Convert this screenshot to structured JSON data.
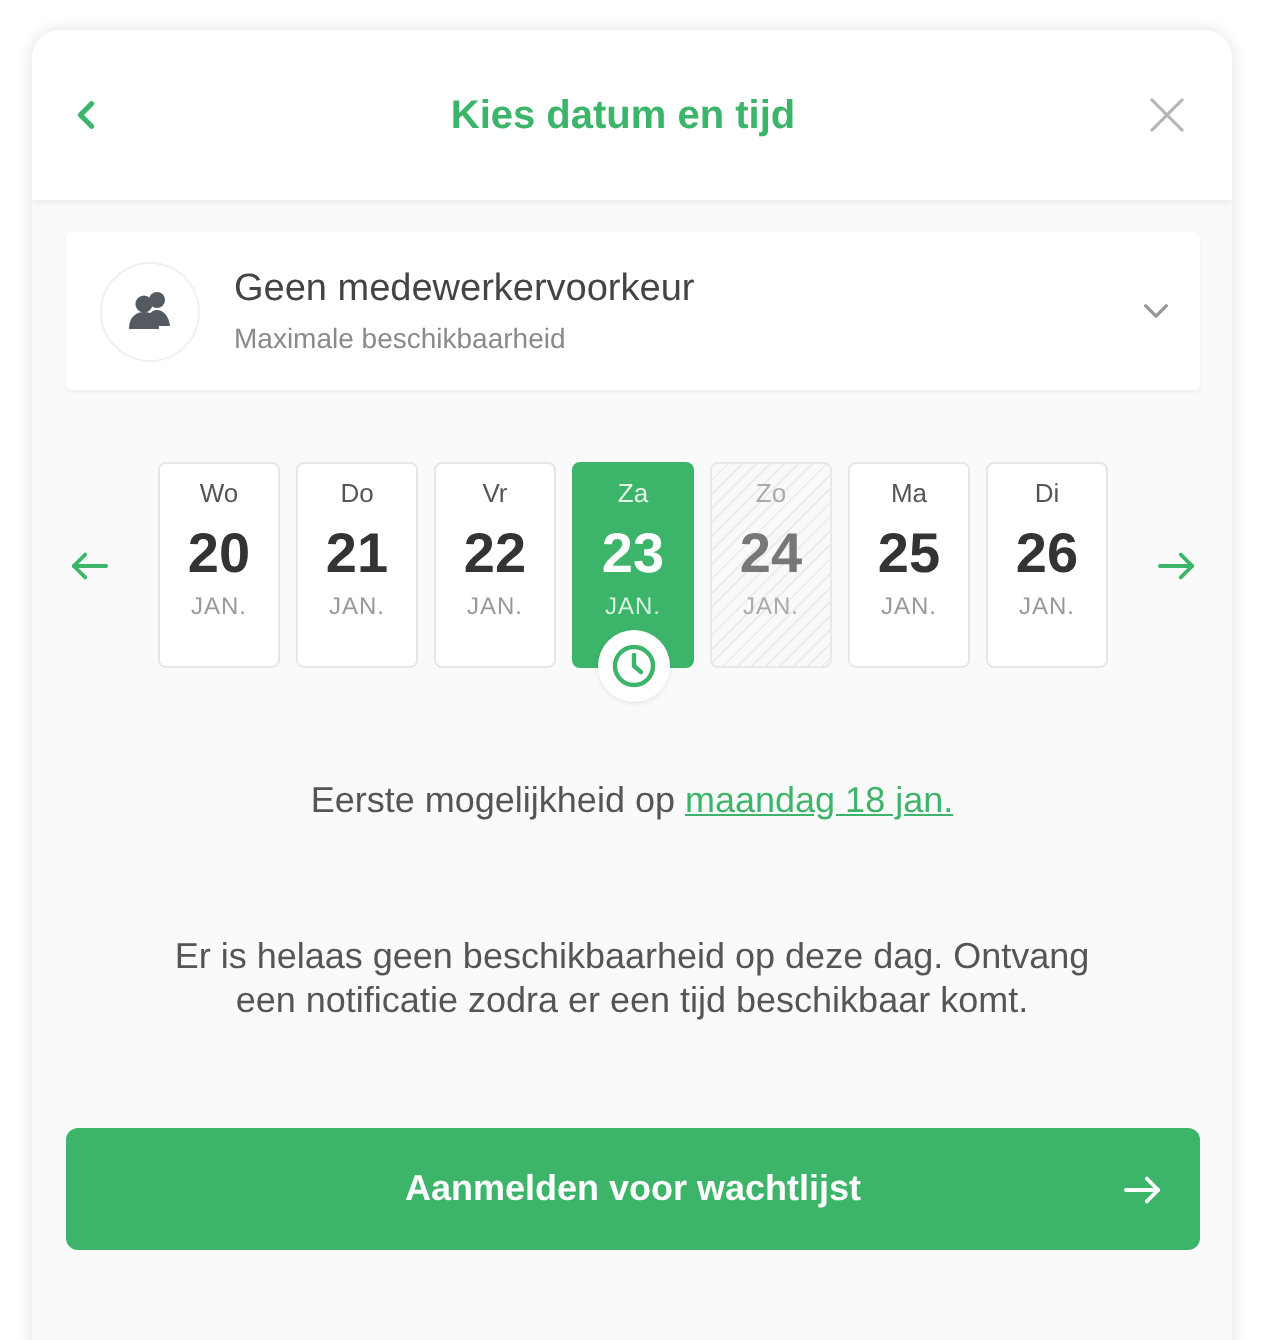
{
  "header": {
    "title": "Kies datum en tijd"
  },
  "staff_select": {
    "title": "Geen medewerkervoorkeur",
    "subtitle": "Maximale beschikbaarheid"
  },
  "days": [
    {
      "weekday": "Wo",
      "day": "20",
      "month": "JAN.",
      "selected": false,
      "disabled": false
    },
    {
      "weekday": "Do",
      "day": "21",
      "month": "JAN.",
      "selected": false,
      "disabled": false
    },
    {
      "weekday": "Vr",
      "day": "22",
      "month": "JAN.",
      "selected": false,
      "disabled": false
    },
    {
      "weekday": "Za",
      "day": "23",
      "month": "JAN.",
      "selected": true,
      "disabled": false
    },
    {
      "weekday": "Zo",
      "day": "24",
      "month": "JAN.",
      "selected": false,
      "disabled": true
    },
    {
      "weekday": "Ma",
      "day": "25",
      "month": "JAN.",
      "selected": false,
      "disabled": false
    },
    {
      "weekday": "Di",
      "day": "26",
      "month": "JAN.",
      "selected": false,
      "disabled": false
    }
  ],
  "first_available": {
    "text": "Eerste mogelijkheid op",
    "link": "maandag 18 jan."
  },
  "message": "Er is helaas geen beschikbaarheid op deze dag. Ontvang een notificatie zodra er een tijd beschikbaar komt.",
  "button": {
    "label": "Aanmelden voor wachtlijst"
  }
}
